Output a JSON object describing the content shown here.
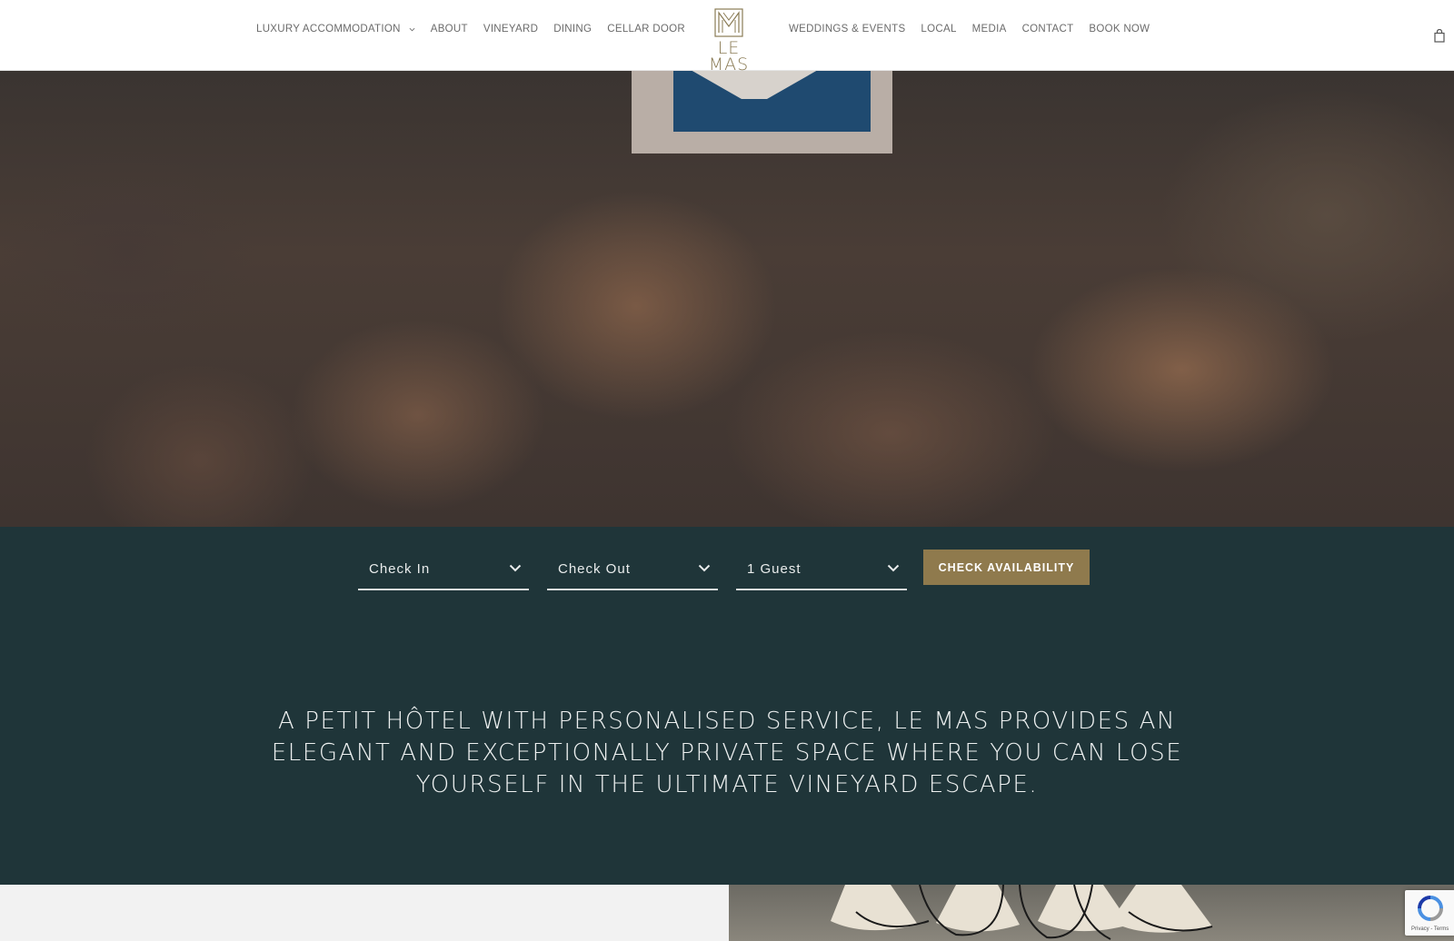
{
  "header": {
    "nav_left": [
      {
        "label": "LUXURY ACCOMMODATION",
        "has_dropdown": true
      },
      {
        "label": "ABOUT"
      },
      {
        "label": "VINEYARD"
      },
      {
        "label": "DINING"
      },
      {
        "label": "CELLAR DOOR"
      }
    ],
    "nav_right": [
      {
        "label": "WEDDINGS & EVENTS"
      },
      {
        "label": "LOCAL"
      },
      {
        "label": "MEDIA"
      },
      {
        "label": "CONTACT"
      },
      {
        "label": "BOOK NOW"
      }
    ],
    "logo_text": "LE MAS",
    "cart_icon": "shopping-bag-icon"
  },
  "booking": {
    "check_in": "Check In",
    "check_out": "Check Out",
    "guests": "1 Guest",
    "button_label": "CHECK AVAILABILITY"
  },
  "tagline": "A PETIT HÔTEL WITH PERSONALISED SERVICE, LE MAS PROVIDES AN ELEGANT AND EXCEPTIONALLY PRIVATE SPACE WHERE YOU CAN LOSE YOURSELF IN THE ULTIMATE VINEYARD ESCAPE.",
  "recaptcha": {
    "label": "Privacy - Terms"
  },
  "colors": {
    "accent_gold": "#8f7a4d",
    "dark_teal": "#1f3539",
    "nav_text": "#6b6b6b"
  }
}
